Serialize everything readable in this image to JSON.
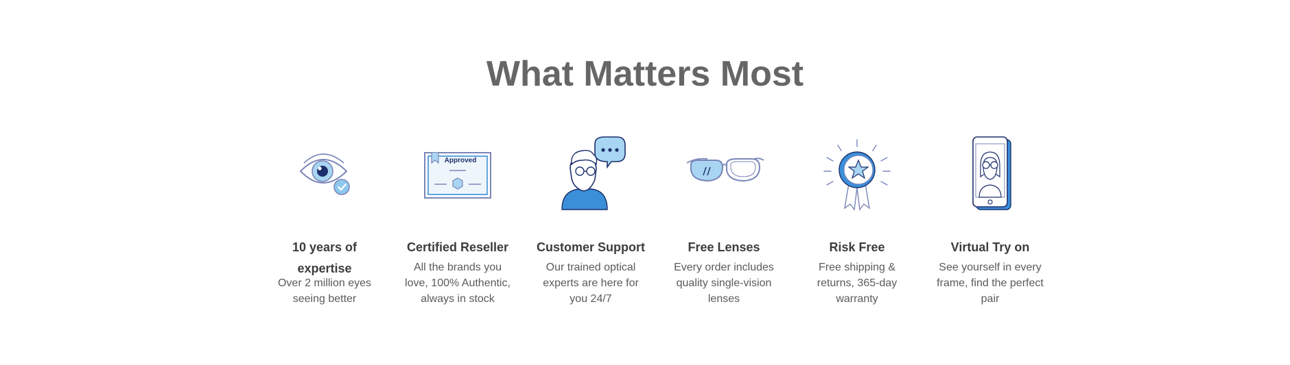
{
  "section": {
    "title": "What Matters Most"
  },
  "colors": {
    "title": "#666666",
    "heading": "#3c3c3c",
    "body": "#5a5a5a",
    "accent_blue": "#3b8fd9",
    "light_blue": "#a8d5f2",
    "outline": "#7a86b8",
    "navy": "#1c2f6b"
  },
  "features": [
    {
      "icon": "eye-check-icon",
      "title": "10 years of expertise",
      "description": "Over 2 million eyes seeing better"
    },
    {
      "icon": "approved-certificate-icon",
      "title": "Certified Reseller",
      "description": "All the brands you love, 100% Authentic, always in stock",
      "badge_text": "Approved"
    },
    {
      "icon": "support-agent-icon",
      "title": "Customer Support",
      "description": "Our trained optical experts are here for you 24/7"
    },
    {
      "icon": "eyeglasses-icon",
      "title": "Free Lenses",
      "description": "Every order includes quality single-vision lenses"
    },
    {
      "icon": "award-ribbon-icon",
      "title": "Risk Free",
      "description": "Free shipping & returns, 365-day warranty"
    },
    {
      "icon": "phone-try-on-icon",
      "title": "Virtual Try on",
      "description": "See yourself in every frame, find the perfect pair"
    }
  ]
}
